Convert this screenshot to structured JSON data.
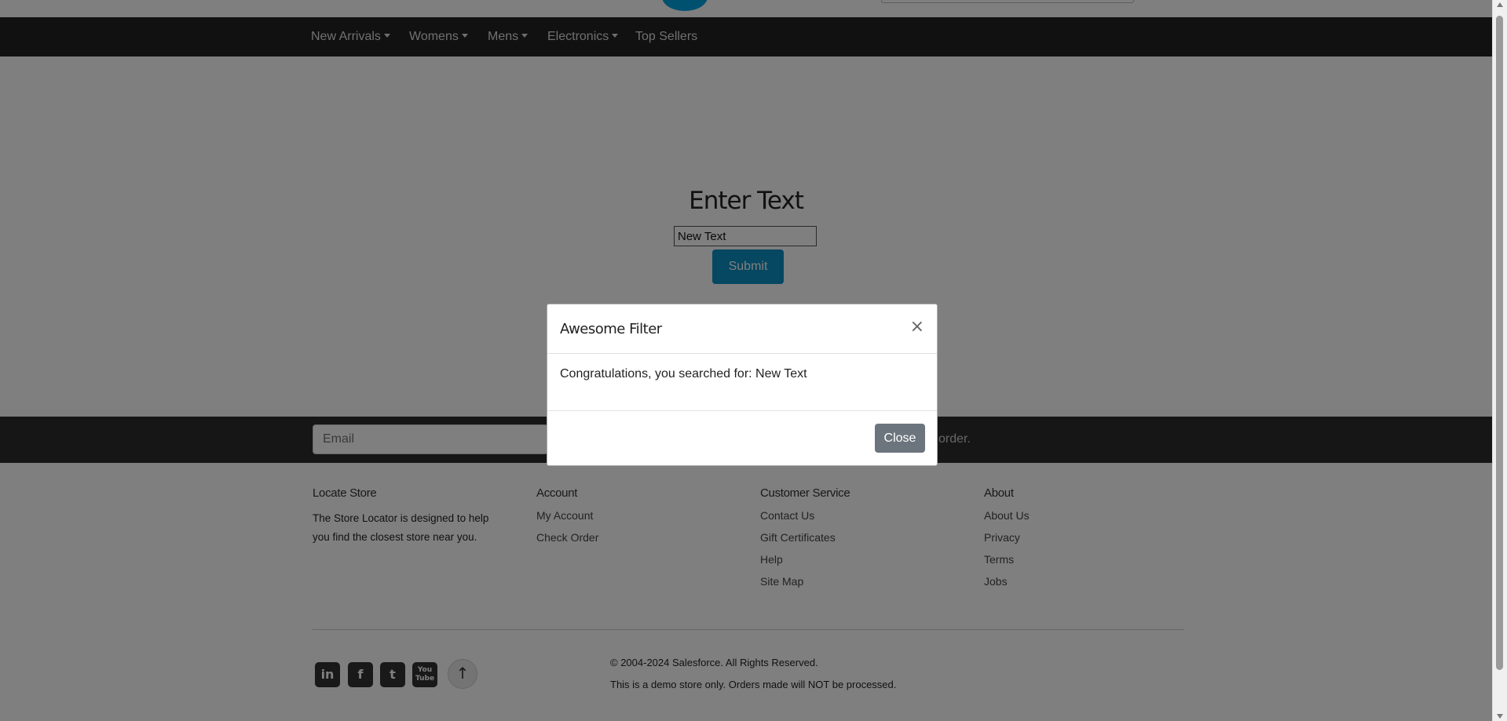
{
  "nav": {
    "items": [
      {
        "label": "New Arrivals",
        "dropdown": true
      },
      {
        "label": "Womens",
        "dropdown": true
      },
      {
        "label": "Mens",
        "dropdown": true
      },
      {
        "label": "Electronics",
        "dropdown": true
      },
      {
        "label": "Top Sellers",
        "dropdown": false
      }
    ]
  },
  "main": {
    "heading": "Enter Text",
    "input_value": "New Text",
    "submit_label": "Submit"
  },
  "subscribe": {
    "email_placeholder": "Email",
    "text_visible": "order."
  },
  "footer": {
    "locate": {
      "title": "Locate Store",
      "description": "The Store Locator is designed to help you find the closest store near you."
    },
    "account": {
      "title": "Account",
      "links": [
        "My Account",
        "Check Order"
      ]
    },
    "customer_service": {
      "title": "Customer Service",
      "links": [
        "Contact Us",
        "Gift Certificates",
        "Help",
        "Site Map"
      ]
    },
    "about": {
      "title": "About",
      "links": [
        "About Us",
        "Privacy",
        "Terms",
        "Jobs"
      ]
    },
    "social": [
      {
        "icon": "linkedin-icon",
        "glyph": "in"
      },
      {
        "icon": "facebook-icon",
        "glyph": "f"
      },
      {
        "icon": "twitter-icon",
        "glyph": "t"
      },
      {
        "icon": "youtube-icon",
        "glyph": "You Tube"
      }
    ],
    "back_to_top_glyph": "↑",
    "copyright": "© 2004-2024 Salesforce. All Rights Reserved.",
    "demo_note": "This is a demo store only. Orders made will NOT be processed."
  },
  "modal": {
    "title": "Awesome Filter",
    "close_x": "×",
    "message": "Congratulations, you searched for: New Text",
    "close_label": "Close"
  },
  "colors": {
    "navbar": "#222222",
    "submit": "#0c8ec2",
    "close_button": "#6c757d",
    "backdrop": "rgba(0,0,0,0.5)"
  }
}
